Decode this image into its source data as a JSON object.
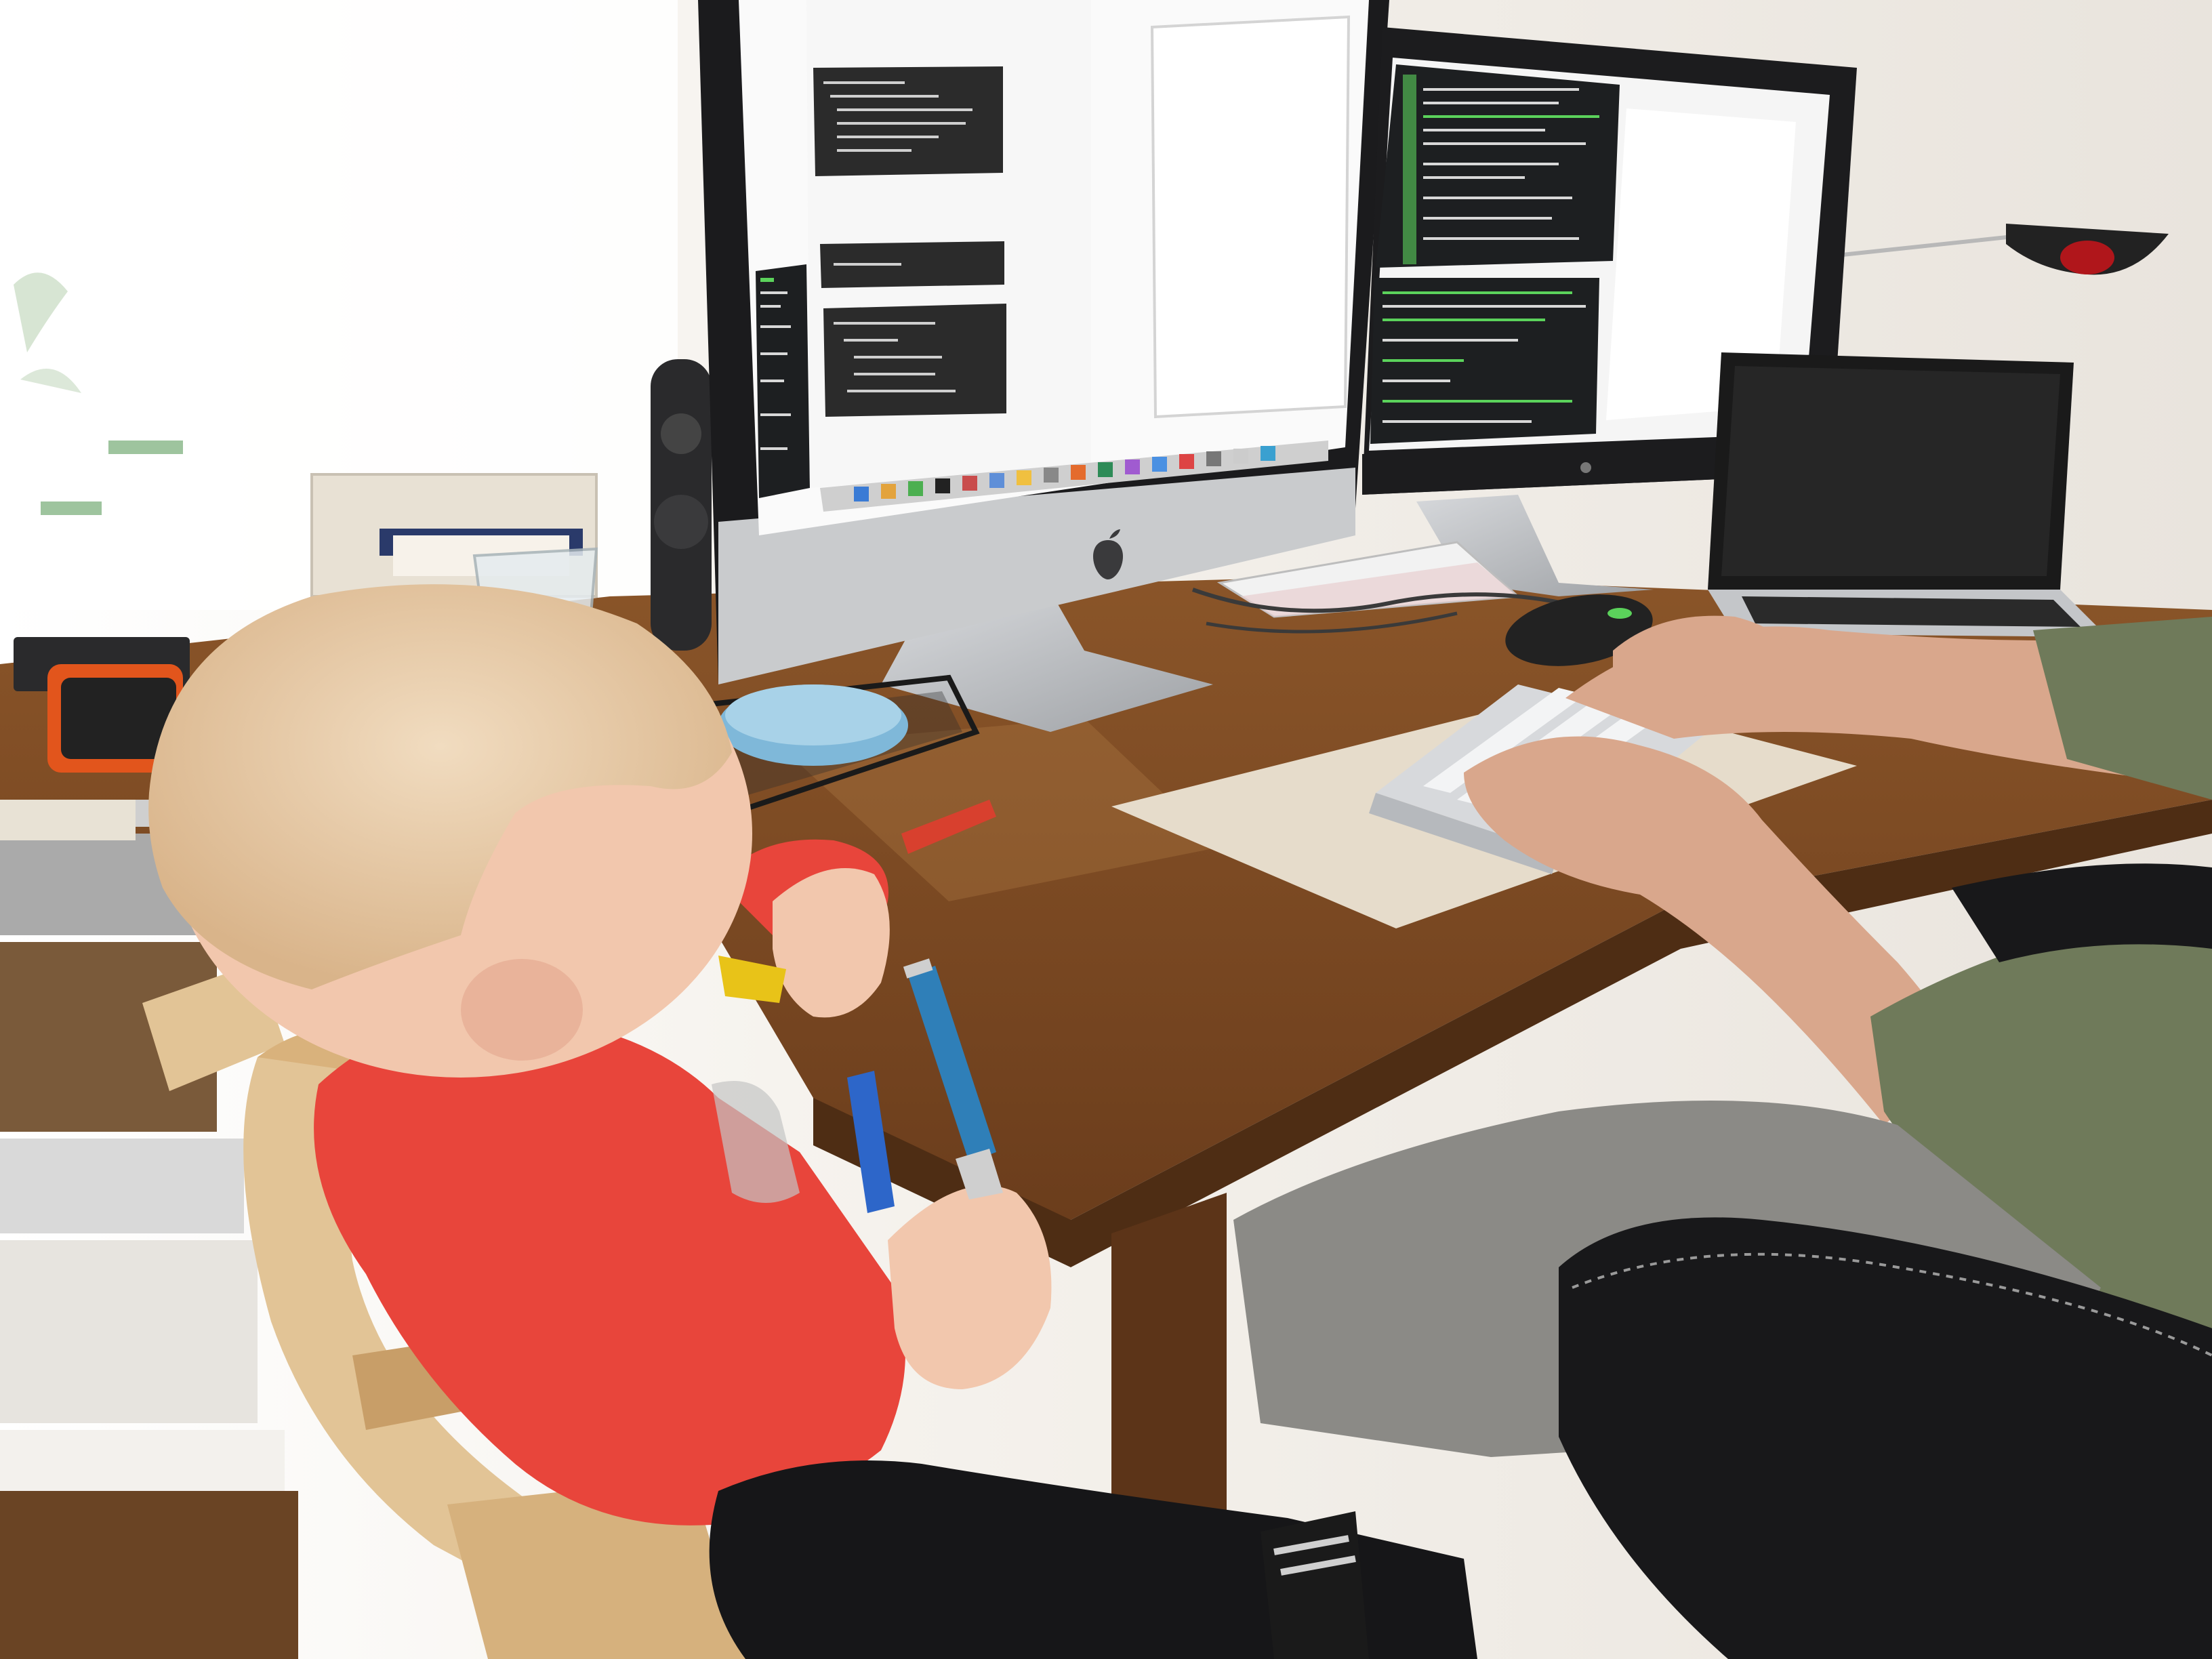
{
  "scene": {
    "colors": {
      "wall": "#f3f0eb",
      "window_glow": "#ffffff",
      "desk": "#7a4a25",
      "desk_highlight": "#a9703f",
      "desk_edge": "#4e2d14",
      "imac_bezel": "#1b1b1d",
      "imac_chin": "#c9cbcd",
      "imac_stand": "#b9bbbe",
      "editor_page": "#f7f7f7",
      "code_block": "#2b2b2b",
      "terminal_bg": "#1d1f21",
      "terminal_green": "#5bd25b",
      "terminal_text": "#d8d8d8",
      "dock": "#cfcfcf",
      "display_frame": "#1c1c1e",
      "laptop_lid": "#1a1a1a",
      "laptop_base": "#c4c6c9",
      "keyboard": "#d7d9dc",
      "mat": "#e6dccb",
      "shirt_red": "#e8453b",
      "skin": "#f2c7ad",
      "hair": "#e8c9a6",
      "high_chair": "#e2c496",
      "arm_skin": "#d9a78c",
      "sleeve_olive": "#6f7a5a",
      "chair_black": "#18181a",
      "pants_gray": "#8b8a86",
      "pen_blue": "#2f7fb8",
      "clip_blue": "#2d66c9",
      "clip_red": "#d8402e",
      "clip_yellow": "#e8c318",
      "speaker": "#2a2a2c",
      "tray_wire": "#1a1a1a",
      "tray_lid": "#7fb8d9"
    },
    "icons": [
      "apple-logo-icon",
      "apple-logo-icon-small",
      "lamp-icon"
    ]
  }
}
